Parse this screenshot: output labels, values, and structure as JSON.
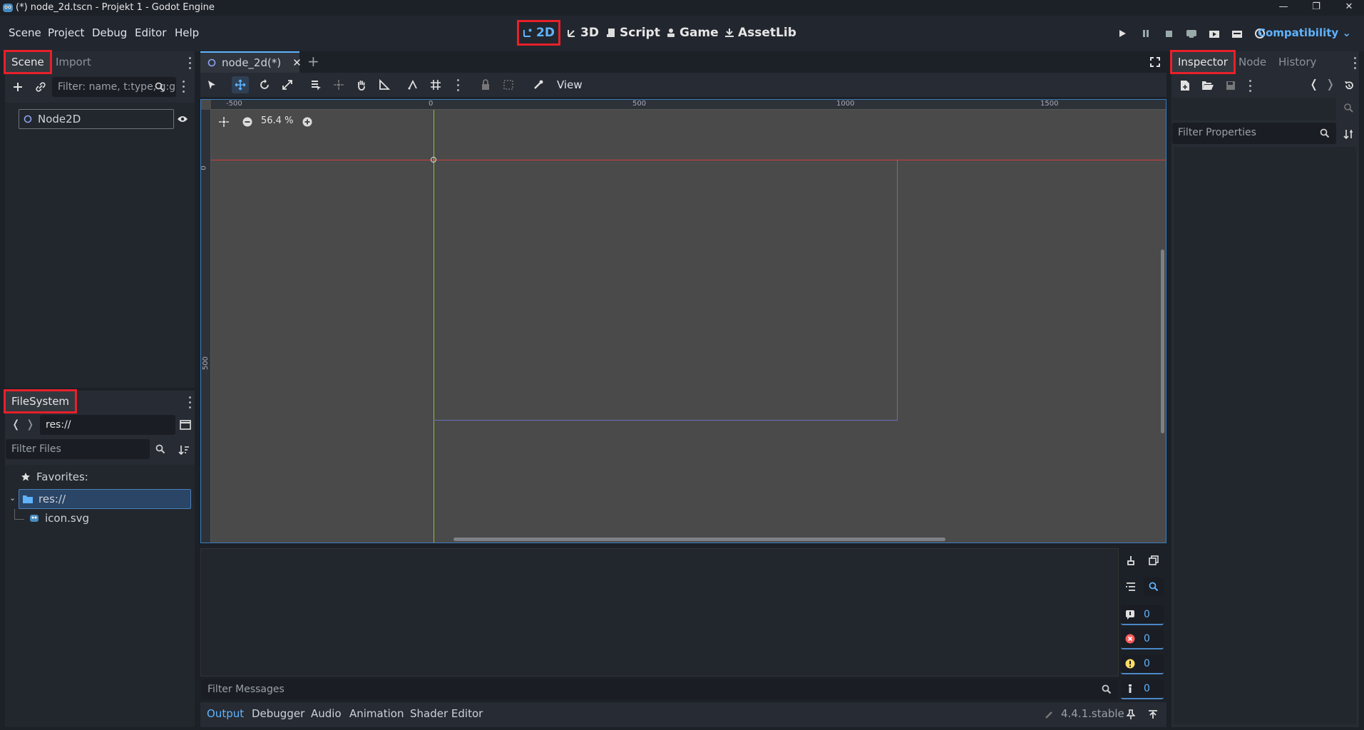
{
  "window": {
    "title": "(*) node_2d.tscn - Projekt 1 - Godot Engine"
  },
  "menu": [
    "Scene",
    "Project",
    "Debug",
    "Editor",
    "Help"
  ],
  "workspaces": [
    {
      "label": "2D",
      "icon": "2d-icon",
      "active": true
    },
    {
      "label": "3D",
      "icon": "3d-icon",
      "active": false
    },
    {
      "label": "Script",
      "icon": "script-icon",
      "active": false
    },
    {
      "label": "Game",
      "icon": "game-icon",
      "active": false
    },
    {
      "label": "AssetLib",
      "icon": "assetlib-icon",
      "active": false
    }
  ],
  "renderer": "Compatibility",
  "scene_dock": {
    "tabs": [
      "Scene",
      "Import"
    ],
    "filter_placeholder": "Filter: name, t:type, g:group",
    "tree": [
      {
        "label": "Node2D",
        "icon": "node2d-icon"
      }
    ]
  },
  "filesystem_dock": {
    "title": "FileSystem",
    "path": "res://",
    "filter_placeholder": "Filter Files",
    "favorites_label": "Favorites:",
    "tree": [
      {
        "label": "res://",
        "icon": "folder-icon",
        "selected": true
      },
      {
        "label": "icon.svg",
        "icon": "svg-file-icon",
        "selected": false
      }
    ]
  },
  "editor_tabs": [
    {
      "label": "node_2d(*)",
      "icon": "node2d-icon"
    }
  ],
  "toolbar": {
    "view_label": "View"
  },
  "viewport": {
    "zoom": "56.4 %",
    "ruler_h": [
      "-500",
      "0",
      "500",
      "1000",
      "1500"
    ],
    "ruler_v": [
      "0",
      "500"
    ]
  },
  "inspector": {
    "tabs": [
      "Inspector",
      "Node",
      "History"
    ],
    "filter_placeholder": "Filter Properties"
  },
  "bottom": {
    "filter_placeholder": "Filter Messages",
    "tabs": [
      "Output",
      "Debugger",
      "Audio",
      "Animation",
      "Shader Editor"
    ],
    "active_tab": "Output",
    "version": "4.4.1.stable",
    "counters": {
      "messages": "0",
      "errors": "0",
      "warnings": "0",
      "info": "0"
    }
  },
  "colors": {
    "accent": "#5fb3ff",
    "highlight_box": "#e8202a",
    "x_axis": "#d33c3c",
    "y_axis": "#8fbf2f",
    "viewport_bg": "#4a4a4a"
  }
}
